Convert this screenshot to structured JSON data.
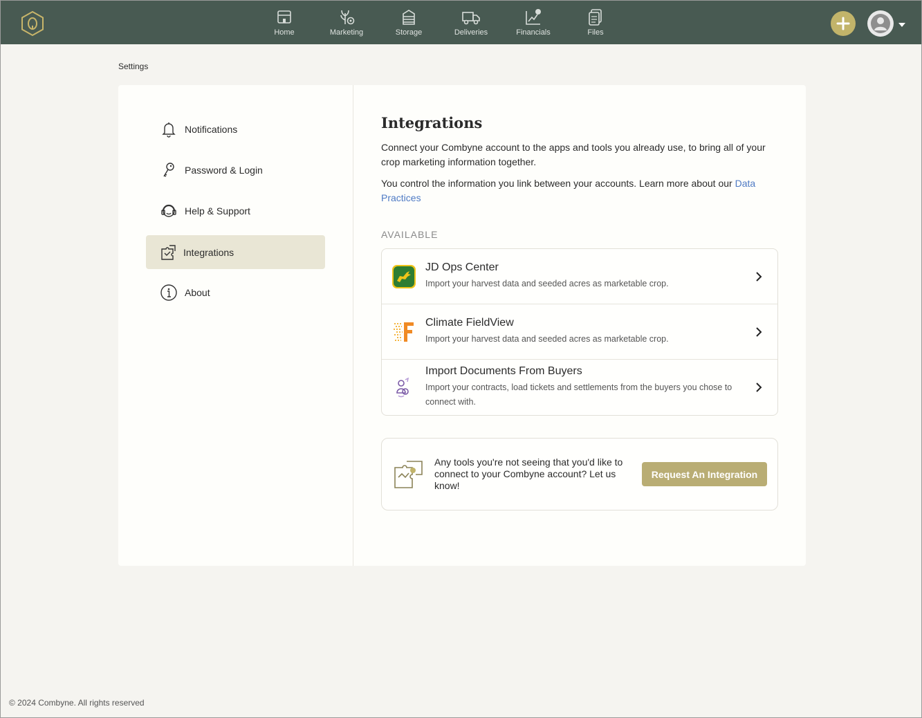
{
  "nav": {
    "items": [
      {
        "label": "Home",
        "icon": "home-icon"
      },
      {
        "label": "Marketing",
        "icon": "marketing-icon"
      },
      {
        "label": "Storage",
        "icon": "storage-icon"
      },
      {
        "label": "Deliveries",
        "icon": "truck-icon"
      },
      {
        "label": "Financials",
        "icon": "financials-icon"
      },
      {
        "label": "Files",
        "icon": "files-icon"
      }
    ]
  },
  "breadcrumb": "Settings",
  "sidebar": {
    "items": [
      {
        "label": "Notifications",
        "icon": "bell-icon"
      },
      {
        "label": "Password & Login",
        "icon": "key-icon"
      },
      {
        "label": "Help & Support",
        "icon": "headset-icon"
      },
      {
        "label": "Integrations",
        "icon": "puzzle-icon",
        "active": true
      },
      {
        "label": "About",
        "icon": "info-icon"
      }
    ]
  },
  "main": {
    "title": "Integrations",
    "intro": "Connect your Combyne account to the apps and tools you already use, to bring all of your crop marketing information together.",
    "control_text": "You control the information you link between your accounts. Learn more about our ",
    "data_practices_link": "Data Practices",
    "section_label": "AVAILABLE",
    "integrations": [
      {
        "title": "JD Ops Center",
        "description": "Import your harvest data and seeded acres as marketable crop.",
        "icon": "john-deere-icon"
      },
      {
        "title": "Climate FieldView",
        "description": "Import your harvest data and seeded acres as marketable crop.",
        "icon": "fieldview-icon"
      },
      {
        "title": "Import Documents From Buyers",
        "description": "Import your contracts, load tickets and settlements from the buyers you chose to connect with.",
        "icon": "buyer-documents-icon"
      }
    ],
    "request": {
      "text": "Any tools you're not seeing that you'd like to connect to your Combyne account? Let us know!",
      "button_label": "Request An Integration"
    }
  },
  "footer": "© 2024 Combyne. All rights reserved",
  "colors": {
    "topbar": "#485a52",
    "accent": "#c2b46a",
    "button": "#b9ad74",
    "link": "#4e7ac4",
    "active_sidebar": "#e9e6d5"
  }
}
